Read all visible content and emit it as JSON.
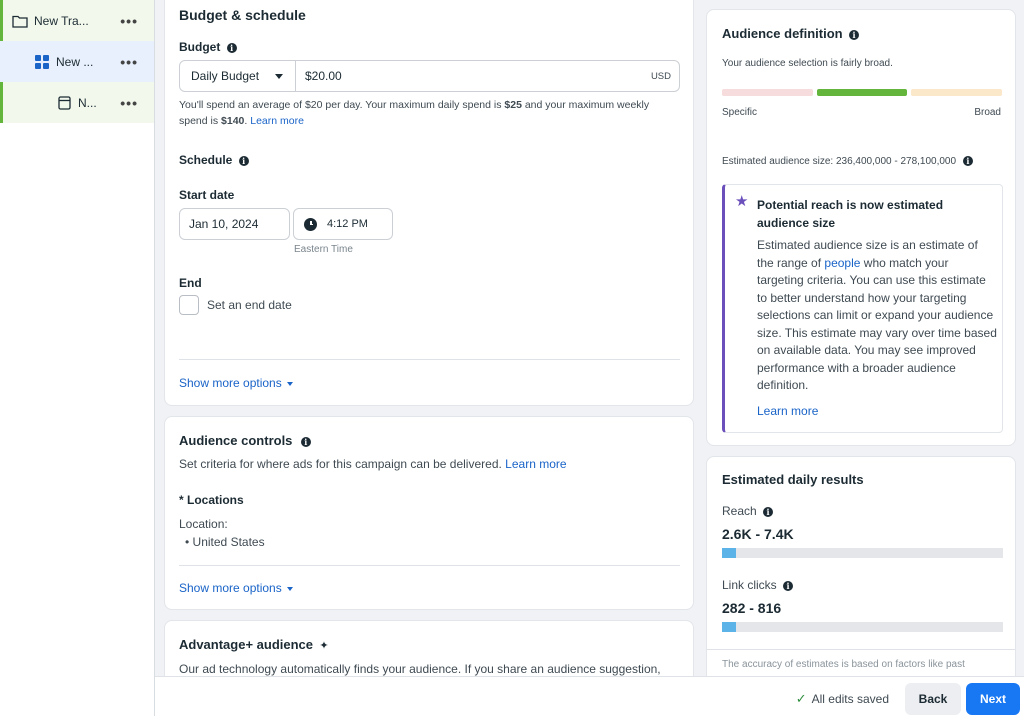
{
  "sidebar": {
    "campaign_label": "New Tra...",
    "adset_label": "New ...",
    "ad_label": "N...",
    "more": "•••"
  },
  "budget": {
    "title": "Budget & schedule",
    "budget_label": "Budget",
    "budget_type": "Daily Budget",
    "amount": "$20.00",
    "currency": "USD",
    "note_pre": "You'll spend an average of $20 per day. Your maximum daily spend is ",
    "note_max_daily": "$25",
    "note_mid": " and your maximum weekly spend is ",
    "note_max_weekly": "$140",
    "note_link": "Learn more",
    "schedule_label": "Schedule",
    "start_label": "Start date",
    "start_date": "Jan 10, 2024",
    "start_time": "4:12 PM",
    "timezone": "Eastern Time",
    "end_label": "End",
    "end_checkbox": "Set an end date",
    "show_more": "Show more options"
  },
  "audience_controls": {
    "title": "Audience controls",
    "desc": "Set criteria for where ads for this campaign can be delivered.",
    "desc_link": "Learn more",
    "locations_label": "* Locations",
    "location_prefix": "Location:",
    "location_value": "United States",
    "show_more": "Show more options"
  },
  "advantage": {
    "title": "Advantage+ audience",
    "desc": "Our ad technology automatically finds your audience. If you share an audience suggestion,"
  },
  "audience_definition": {
    "title": "Audience definition",
    "summary": "Your audience selection is fairly broad.",
    "specific": "Specific",
    "broad": "Broad",
    "size_line": "Estimated audience size: 236,400,000 - 278,100,000",
    "notice_title": "Potential reach is now estimated audience size",
    "notice_pre": "Estimated audience size is an estimate of the range of ",
    "notice_link": "people",
    "notice_post": " who match your targeting criteria. You can use this estimate to better understand how your targeting selections can limit or expand your audience size. This estimate may vary over time based on available data. You may see improved performance with a broader audience definition.",
    "notice_learn": "Learn more",
    "colors": {
      "specific": "#f6dcdc",
      "fairly_broad": "#63b53b",
      "broad": "#fbe7c9",
      "notice_accent": "#6b4fbb"
    }
  },
  "daily_results": {
    "title": "Estimated daily results",
    "reach_label": "Reach",
    "reach_value": "2.6K - 7.4K",
    "reach_fraction": 0.05,
    "clicks_label": "Link clicks",
    "clicks_value": "282 - 816",
    "clicks_fraction": 0.05,
    "accuracy_note": "The accuracy of estimates is based on factors like past"
  },
  "footer": {
    "saved": "All edits saved",
    "back": "Back",
    "next": "Next"
  }
}
